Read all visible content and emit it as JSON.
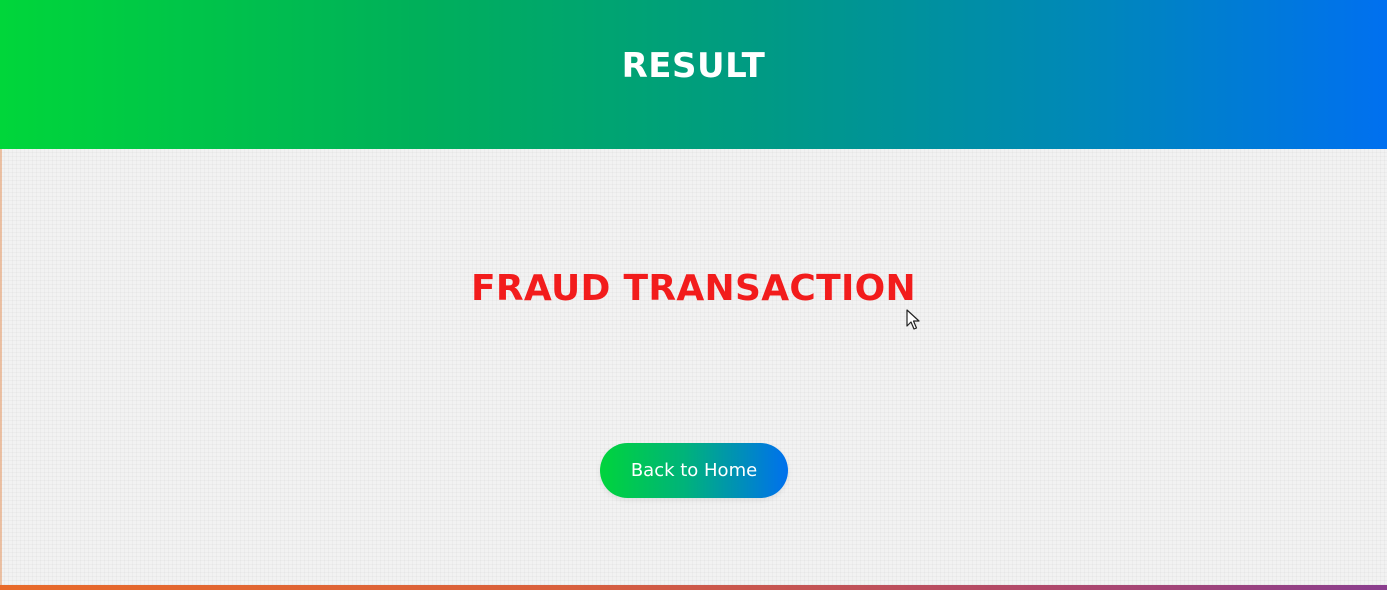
{
  "header": {
    "title": "RESULT",
    "gradient_start": "#00d63a",
    "gradient_end": "#0070f0"
  },
  "main": {
    "result_text": "FRAUD TRANSACTION",
    "result_color": "#f21c1c"
  },
  "button": {
    "label": "Back to Home"
  },
  "cursor": {
    "icon": "mouse-pointer-icon"
  },
  "footer": {
    "bar_colors": [
      "#e86a2a",
      "#8a3e8e"
    ]
  }
}
